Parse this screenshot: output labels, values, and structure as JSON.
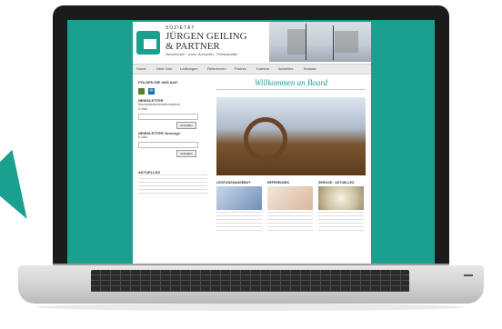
{
  "site": {
    "logo_letter": "G",
    "firm_prefix": "SOZIETÄT",
    "firm_name_line1": "JÜRGEN GEILING",
    "firm_name_line2": "& PARTNER",
    "tagline": "Steuerberater · vereid. Buchprüfer · Rechtsanwälte"
  },
  "nav": {
    "items": [
      "Home",
      "Über Uns",
      "Leistungen",
      "Referenzen",
      "Partner",
      "Karriere",
      "Aktuelles",
      "Kontakt"
    ]
  },
  "sidebar": {
    "social_heading": "FOLGEN SIE UNS AUF:",
    "social_in": "in",
    "newsletter1_heading": "NEWSLETTER",
    "newsletter1_text": "Mandanteninformationsdienst",
    "newsletter2_heading": "NEWSLETTER Vorsorge",
    "email_label": "E-Mail",
    "submit_label": "anmelden",
    "aktuelles_heading": "AKTUELLES"
  },
  "main": {
    "welcome": "Willkommen an Board",
    "columns": [
      {
        "heading": "LEISTUNGSANGEBOT"
      },
      {
        "heading": "REFERENZEN"
      },
      {
        "heading": "SERVICE · AKTUELLES"
      }
    ]
  },
  "colors": {
    "accent": "#1aa08f",
    "nav_bg": "#e9ebe8"
  }
}
